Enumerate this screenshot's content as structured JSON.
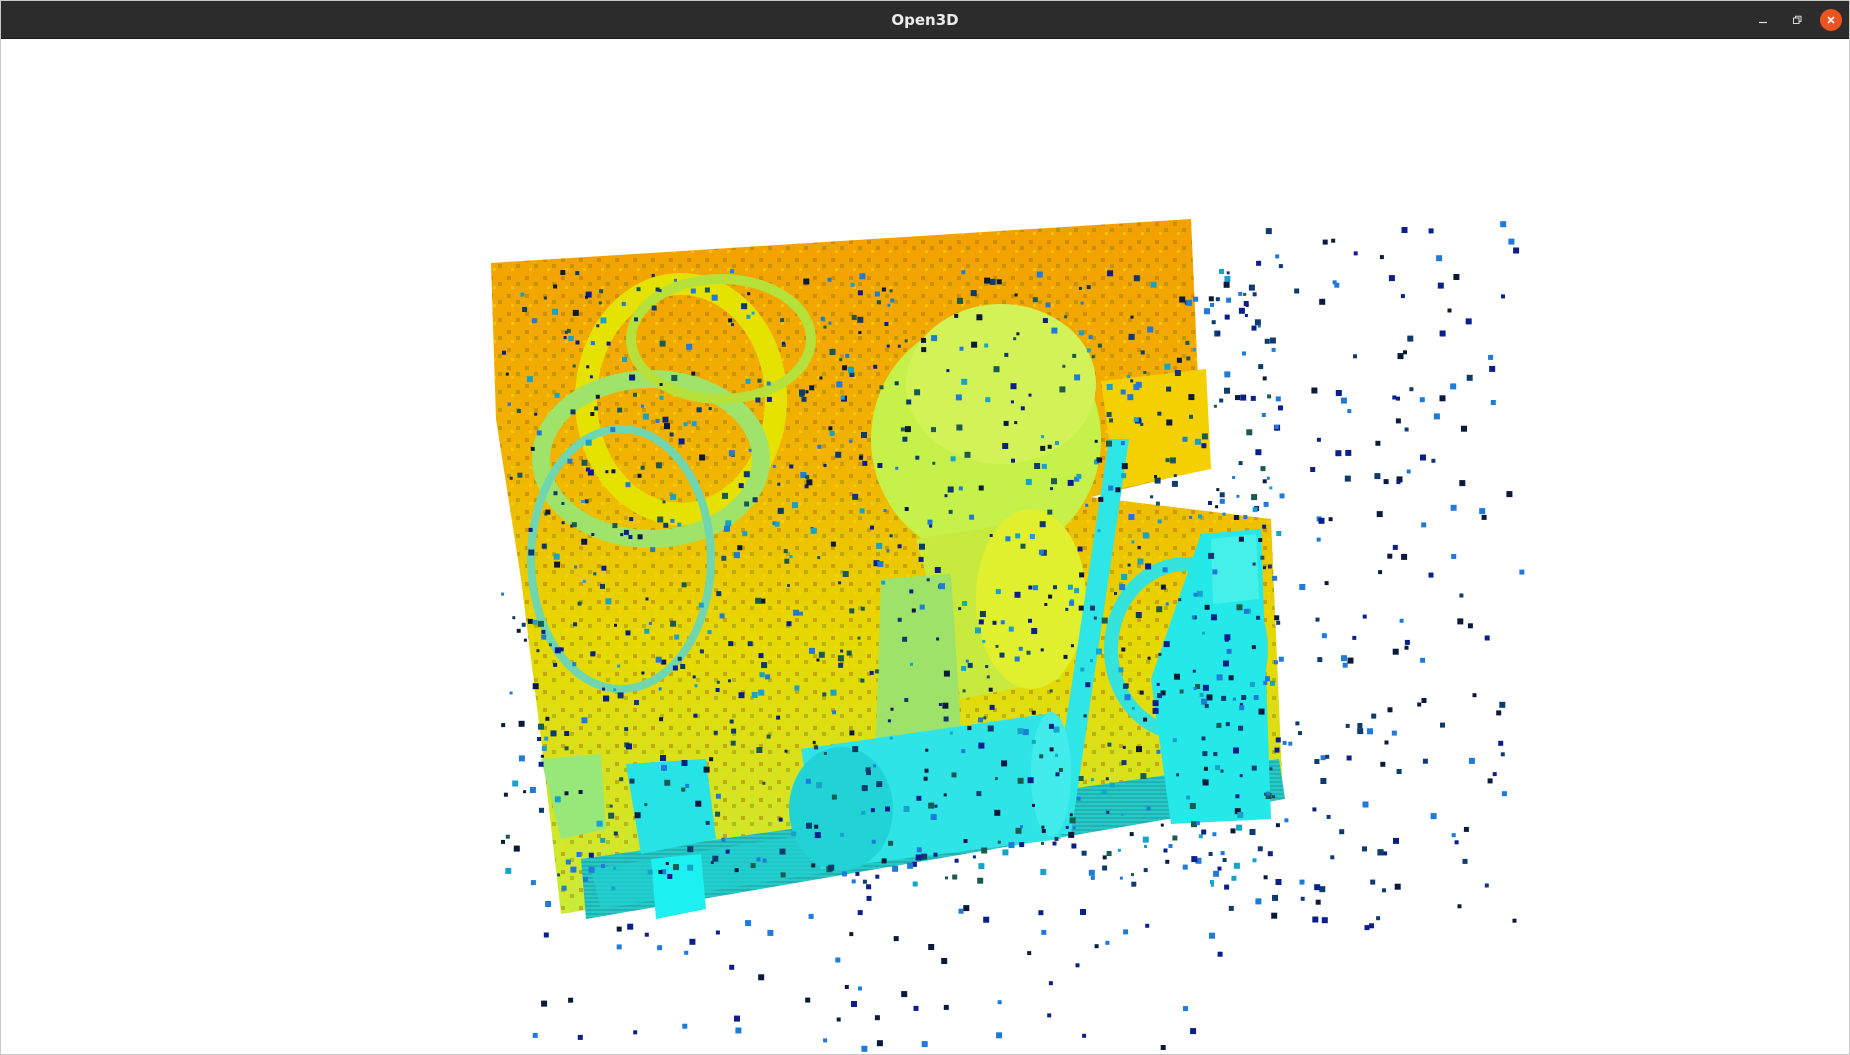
{
  "window": {
    "title": "Open3D"
  },
  "controls": {
    "minimize_icon": "minimize-icon",
    "maximize_icon": "restore-icon",
    "close_icon": "close-icon"
  },
  "colors": {
    "titlebar": "#2c2c2c",
    "title_text": "#ececec",
    "close_button": "#e95420",
    "background": "#ffffff"
  },
  "scene": {
    "type": "point cloud",
    "colormap": [
      "#f7a500",
      "#f4d500",
      "#d6f23a",
      "#9ef05c",
      "#3fe6d2",
      "#1fe9ea",
      "#1f7ad9",
      "#0b1f8c",
      "#0a1a3a"
    ]
  }
}
